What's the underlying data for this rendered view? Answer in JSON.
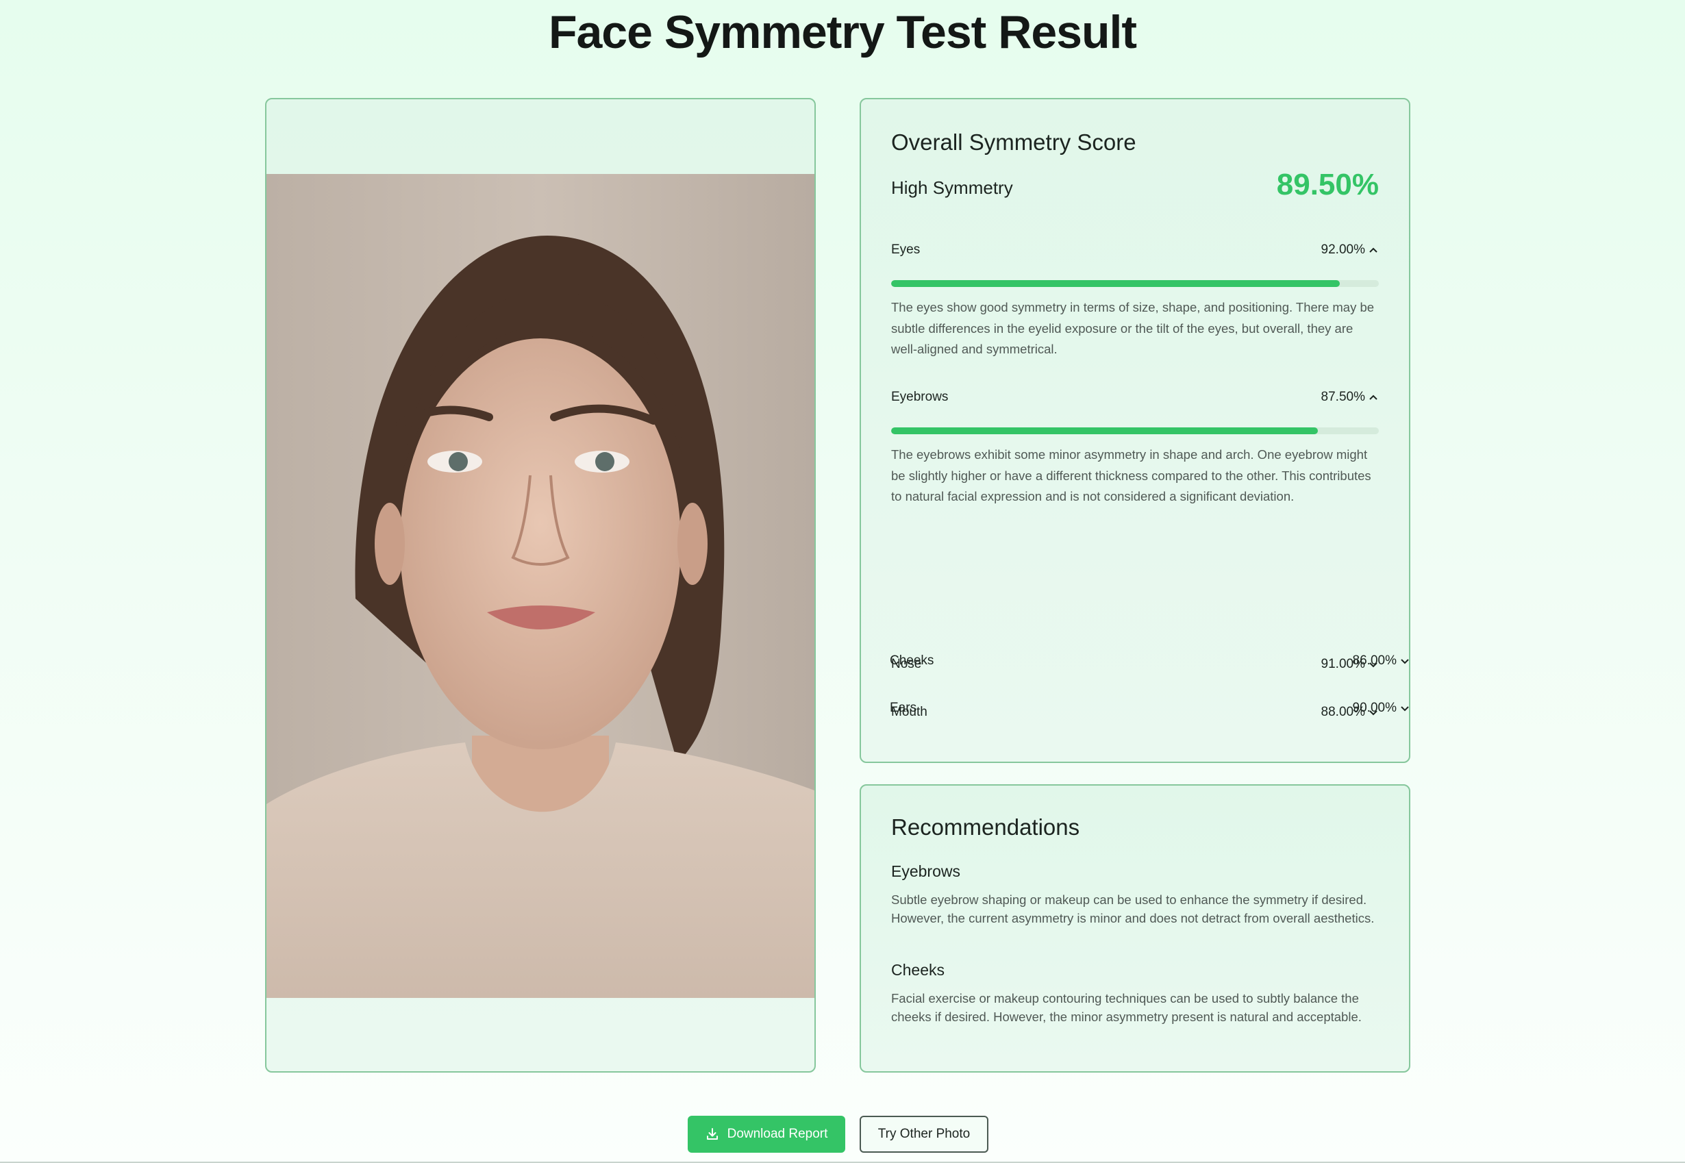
{
  "page": {
    "title": "Face Symmetry Test Result"
  },
  "score": {
    "heading": "Overall Symmetry Score",
    "level": "High Symmetry",
    "overall": "89.50%",
    "accent_color": "#34c466"
  },
  "metrics": [
    {
      "name": "Eyes",
      "value": "92.00%",
      "fraction": 0.92,
      "expanded": true,
      "icon": "chevron-up-icon",
      "description": "The eyes show good symmetry in terms of size, shape, and positioning. There may be subtle differences in the eyelid exposure or the tilt of the eyes, but overall, they are well-aligned and symmetrical."
    },
    {
      "name": "Eyebrows",
      "value": "87.50%",
      "fraction": 0.875,
      "expanded": true,
      "icon": "chevron-up-icon",
      "description": "The eyebrows exhibit some minor asymmetry in shape and arch. One eyebrow might be slightly higher or have a different thickness compared to the other. This contributes to natural facial expression and is not considered a significant deviation."
    },
    {
      "name": "Nose",
      "value": "91.00%",
      "fraction": 0.91,
      "expanded": false,
      "icon": "chevron-down-icon"
    },
    {
      "name": "Mouth",
      "value": "88.00%",
      "fraction": 0.88,
      "expanded": false,
      "icon": "chevron-down-icon"
    },
    {
      "name": "Cheeks",
      "value": "86.00%",
      "fraction": 0.86,
      "expanded": false,
      "icon": "chevron-down-icon"
    },
    {
      "name": "Ears",
      "value": "90.00%",
      "fraction": 0.9,
      "expanded": false,
      "icon": "chevron-down-icon"
    }
  ],
  "recommendations": {
    "heading": "Recommendations",
    "items": [
      {
        "title": "Eyebrows",
        "text": "Subtle eyebrow shaping or makeup can be used to enhance the symmetry if desired. However, the current asymmetry is minor and does not detract from overall aesthetics."
      },
      {
        "title": "Cheeks",
        "text": "Facial exercise or makeup contouring techniques can be used to subtly balance the cheeks if desired. However, the minor asymmetry present is natural and acceptable."
      }
    ]
  },
  "actions": {
    "download_label": "Download Report",
    "download_icon": "download-icon",
    "retry_label": "Try Other Photo"
  }
}
